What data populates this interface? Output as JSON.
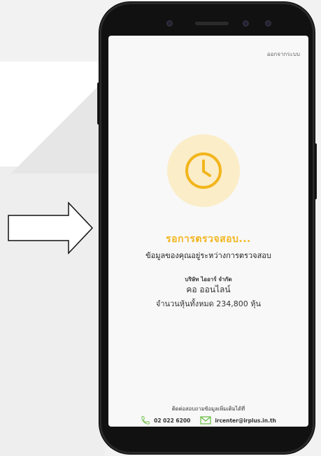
{
  "screen": {
    "logout_label": "ออกจากระบบ",
    "status_title": "รอการตรวจสอบ...",
    "status_subtitle": "ข้อมูลของคุณอยู่ระหว่างการตรวจสอบ",
    "company_name": "บริษัท ไออาร์ จำกัด",
    "holder_name": "คอ ออนไลน์",
    "shares_text": "จำนวนหุ้นทั้งหมด 234,800 หุ้น",
    "contact_title": "ติดต่อสอบถามข้อมูลเพิ่มเติมได้ที่",
    "phone": "02 022 6200",
    "email": "ircenter@irplus.in.th"
  },
  "colors": {
    "accent": "#f2b51c",
    "accent_light": "#fbedc8",
    "contact_icon": "#6fbf4a"
  },
  "icons": [
    "clock-icon",
    "phone-icon",
    "mail-icon",
    "right-arrow-icon"
  ]
}
